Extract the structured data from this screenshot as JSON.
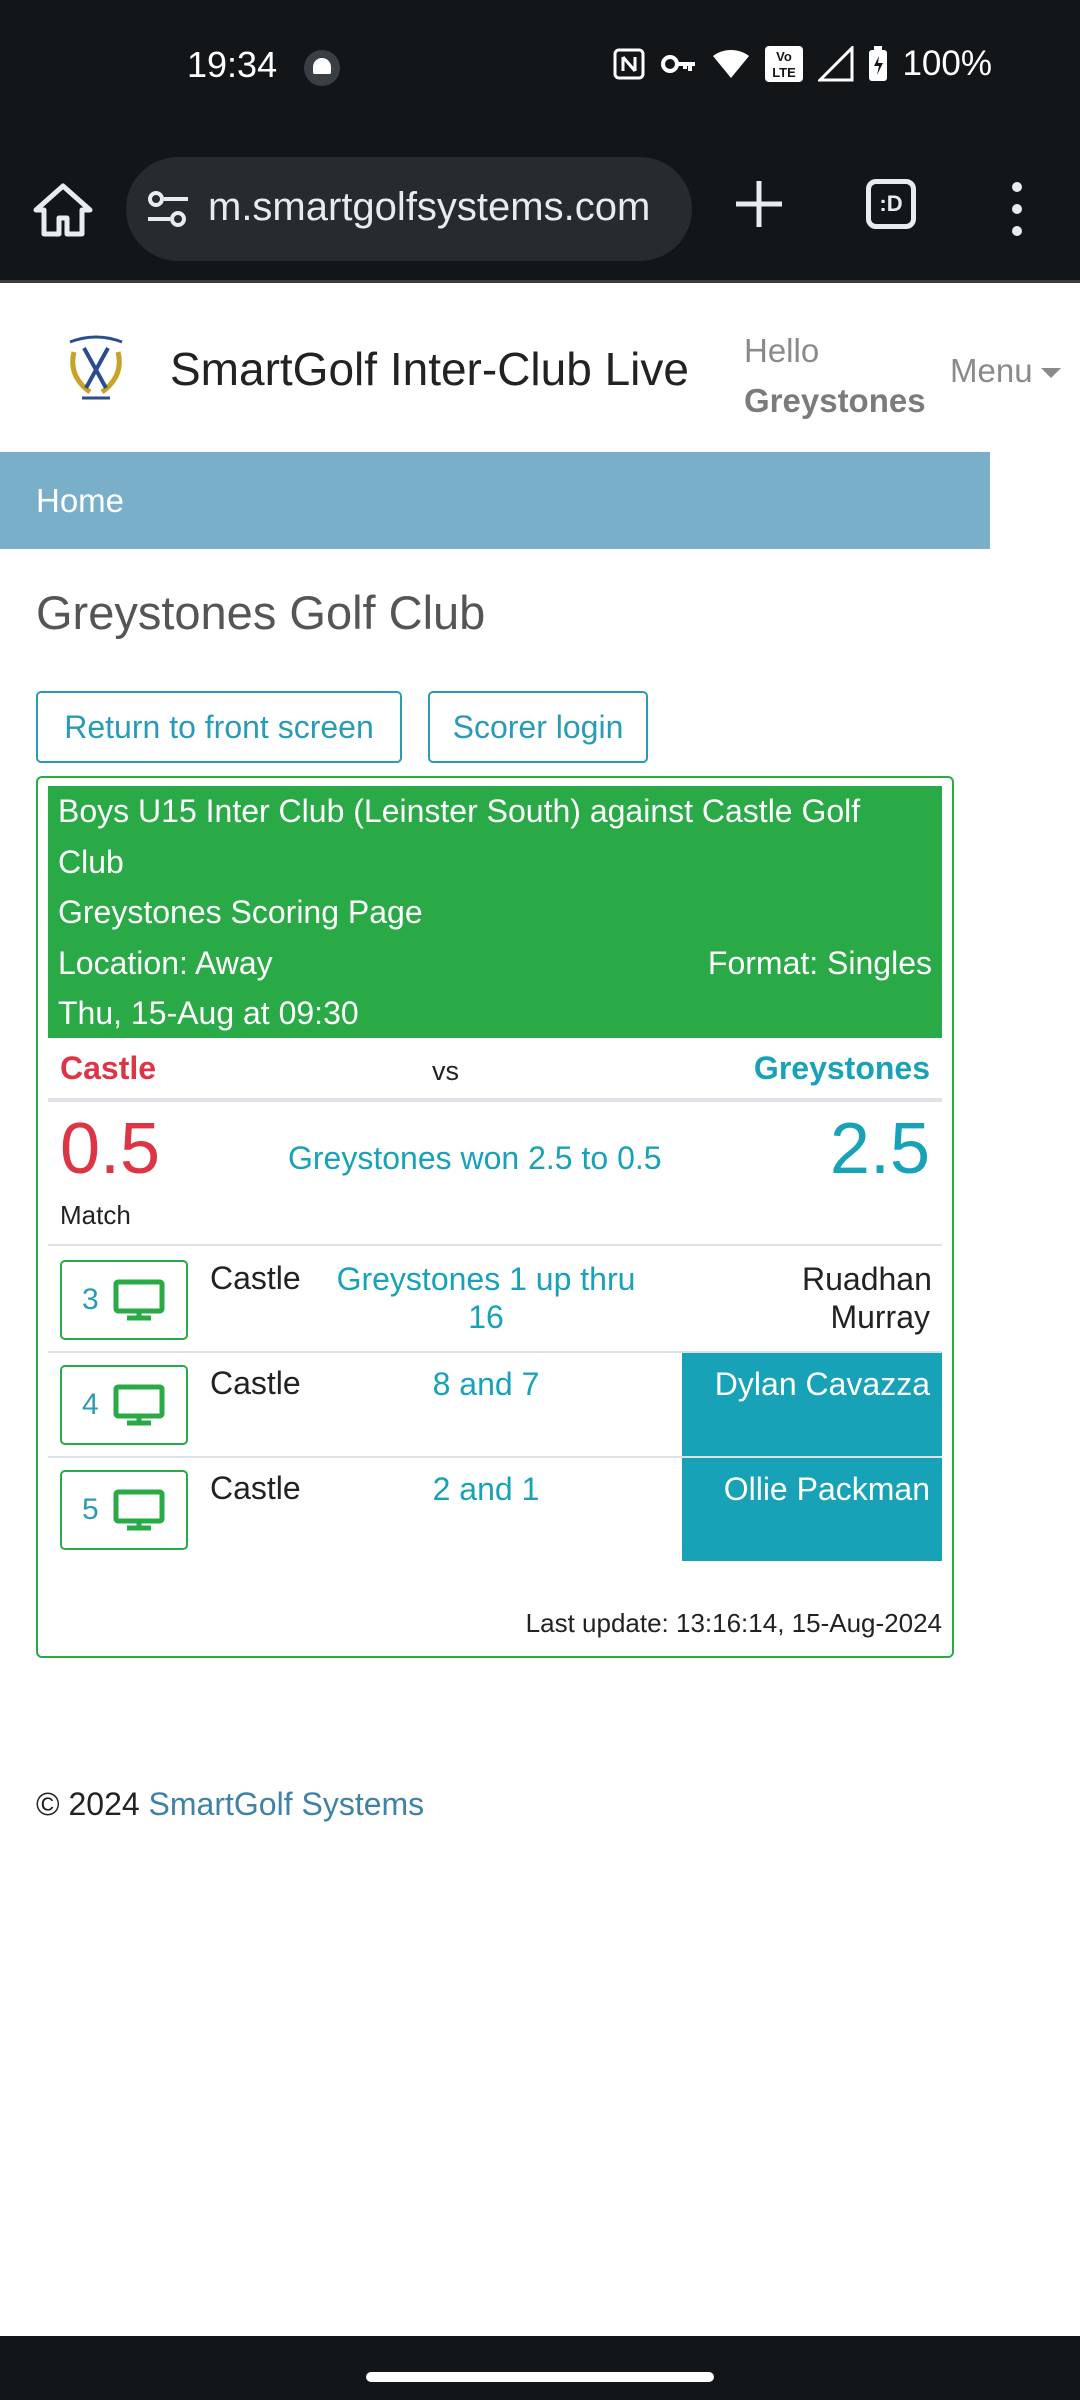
{
  "status": {
    "time": "19:34",
    "battery": "100%",
    "lte_top": "Vo",
    "lte_bottom": "LTE"
  },
  "browser": {
    "url": "m.smartgolfsystems.com",
    "tabs_label": ":D"
  },
  "header": {
    "title": "SmartGolf Inter-Club Live",
    "hello": "Hello",
    "user": "Greystones",
    "menu": "Menu"
  },
  "breadcrumb": {
    "home": "Home"
  },
  "club_title": "Greystones Golf Club",
  "buttons": {
    "front": "Return to front screen",
    "scorer": "Scorer login"
  },
  "match": {
    "title": "Boys U15 Inter Club (Leinster South) against Castle Golf Club",
    "subtitle": "Greystones Scoring Page",
    "location": "Location: Away",
    "format": "Format: Singles",
    "date": "Thu, 15-Aug at 09:30",
    "team_left": "Castle",
    "vs": "vs",
    "team_right": "Greystones",
    "score_left": "0.5",
    "score_label": "Match",
    "result": "Greystones won 2.5 to 0.5",
    "score_right": "2.5",
    "games": [
      {
        "number": "3",
        "opponent": "Castle",
        "result": "Greystones 1 up thru 16",
        "player": "Ruadhan Murray",
        "won": false
      },
      {
        "number": "4",
        "opponent": "Castle",
        "result": "8 and 7",
        "player": "Dylan Cavazza",
        "won": true
      },
      {
        "number": "5",
        "opponent": "Castle",
        "result": "2 and 1",
        "player": "Ollie Packman",
        "won": true
      }
    ],
    "last_update": "Last update: 13:16:14, 15-Aug-2024"
  },
  "footer": {
    "copyright": "© 2024",
    "link": "SmartGolf Systems"
  },
  "colors": {
    "green": "#2aaa47",
    "teal": "#17a2b8",
    "red": "#dc3545",
    "crumb": "#7aafca"
  },
  "icons": [
    "home-icon",
    "site-settings-icon",
    "plus-icon",
    "kebab-icon",
    "monitor-icon",
    "wifi-icon",
    "signal-icon",
    "battery-icon",
    "key-icon",
    "nfc-icon"
  ]
}
